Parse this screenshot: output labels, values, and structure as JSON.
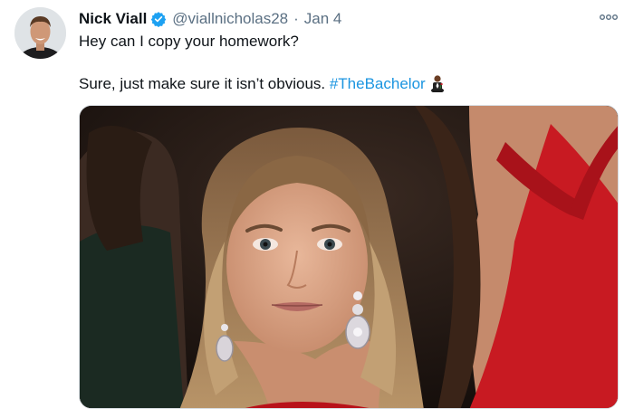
{
  "tweet": {
    "author": {
      "display_name": "Nick Viall",
      "handle": "@viallnicholas28",
      "verified": true,
      "avatar_icon": "profile-photo"
    },
    "separator": "·",
    "date": "Jan 4",
    "more_icon": "more-icon",
    "text_line1": "Hey can I copy your homework?",
    "text_line2_prefix": "Sure, just make sure it isn’t obvious. ",
    "hashtag": "#TheBachelor",
    "hashtag_emoji_icon": "bachelor-rose-emoji",
    "media": {
      "type": "photo",
      "description_icon": "tweet-photo"
    }
  },
  "colors": {
    "text": "#0f1419",
    "secondary": "#5b7083",
    "link": "#1b95e0",
    "verified": "#1da1f2"
  }
}
